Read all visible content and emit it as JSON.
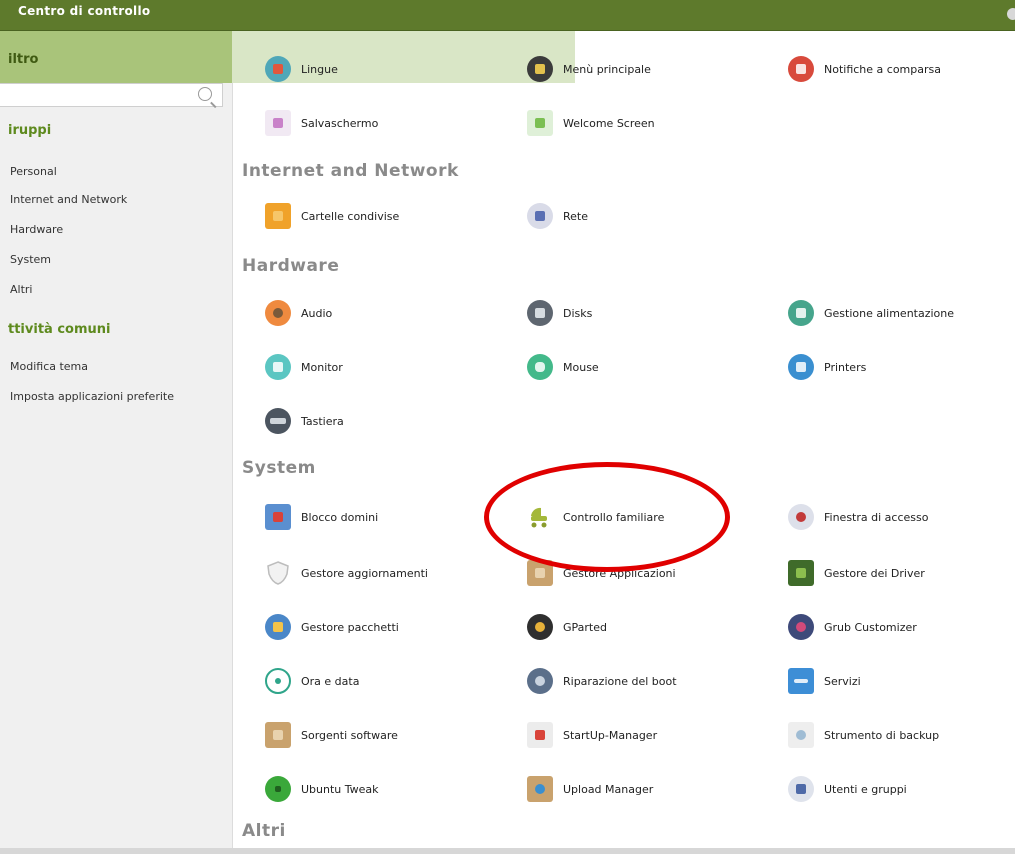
{
  "window": {
    "title": "Centro di controllo"
  },
  "sidebar": {
    "filter_label": "iltro",
    "groups_heading": "iruppi",
    "groups": [
      "Personal",
      "Internet and Network",
      "Hardware",
      "System",
      "Altri"
    ],
    "common_heading": "ttività comuni",
    "common": [
      "Modifica tema",
      "Imposta applicazioni preferite"
    ]
  },
  "sections": {
    "internet": "Internet and Network",
    "hardware": "Hardware",
    "system": "System",
    "altri": "Altri"
  },
  "items": {
    "lingue": "Lingue",
    "menu_principale": "Menù principale",
    "notifiche": "Notifiche a comparsa",
    "salvaschermo": "Salvaschermo",
    "welcome": "Welcome Screen",
    "cartelle": "Cartelle condivise",
    "rete": "Rete",
    "audio": "Audio",
    "disks": "Disks",
    "alimentazione": "Gestione alimentazione",
    "monitor": "Monitor",
    "mouse": "Mouse",
    "printers": "Printers",
    "tastiera": "Tastiera",
    "blocco_domini": "Blocco domini",
    "controllo_familiare": "Controllo familiare",
    "finestra_accesso": "Finestra di accesso",
    "gestore_aggiornamenti": "Gestore aggiornamenti",
    "gestore_applicazioni": "Gestore Applicazioni",
    "gestore_driver": "Gestore dei Driver",
    "gestore_pacchetti": "Gestore pacchetti",
    "gparted": "GParted",
    "grub": "Grub Customizer",
    "ora_data": "Ora e data",
    "riparazione_boot": "Riparazione del boot",
    "servizi": "Servizi",
    "sorgenti": "Sorgenti software",
    "startup": "StartUp-Manager",
    "backup": "Strumento di backup",
    "tweak": "Ubuntu Tweak",
    "upload": "Upload Manager",
    "utenti": "Utenti e gruppi"
  },
  "colors": {
    "titlebar": "#5e7a2c",
    "accent": "#5e8a1e",
    "highlight_ring": "#e00000"
  }
}
